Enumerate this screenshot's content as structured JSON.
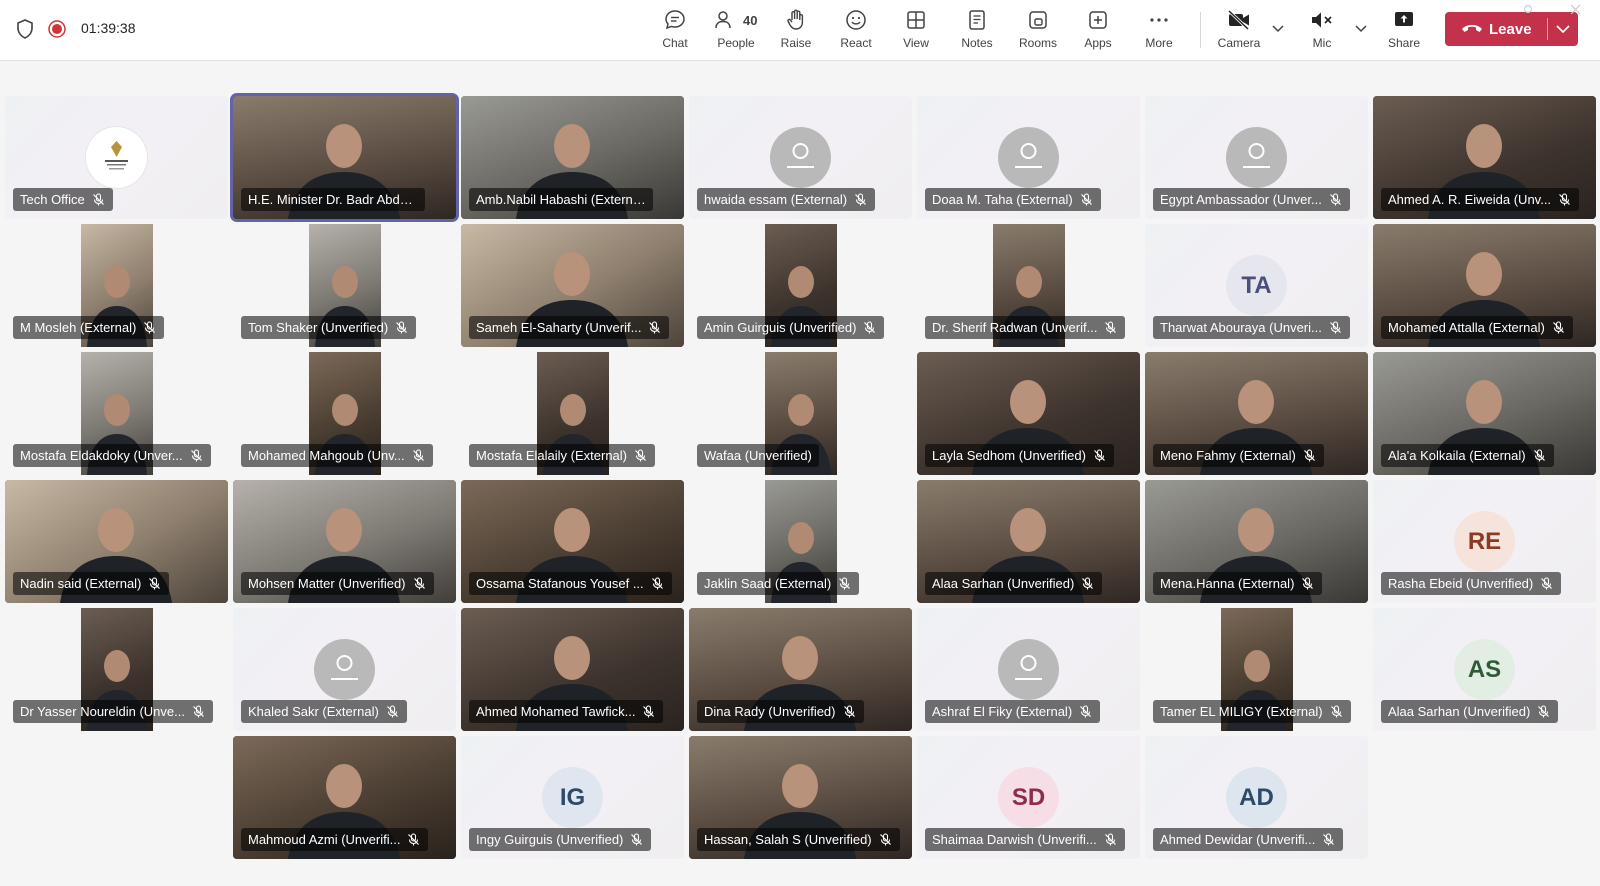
{
  "toolbar": {
    "timer": "01:39:38",
    "chat_label": "Chat",
    "people_label": "People",
    "people_count": "40",
    "raise_label": "Raise",
    "react_label": "React",
    "view_label": "View",
    "notes_label": "Notes",
    "rooms_label": "Rooms",
    "apps_label": "Apps",
    "more_label": "More",
    "camera_label": "Camera",
    "mic_label": "Mic",
    "share_label": "Share",
    "leave_label": "Leave"
  },
  "colors": {
    "leave_red": "#c4314b",
    "active_speaker": "#6264a7",
    "recording_red": "#d13438"
  },
  "participants": [
    {
      "name": "Tech Office",
      "kind": "logo",
      "muted": true
    },
    {
      "name": "H.E. Minister Dr. Badr Abdelatt...",
      "kind": "video",
      "muted": false,
      "active": true
    },
    {
      "name": "Amb.Nabil Habashi (External)",
      "kind": "video",
      "muted": false
    },
    {
      "name": "hwaida essam (External)",
      "kind": "generic-avatar",
      "muted": true
    },
    {
      "name": "Doaa M. Taha (External)",
      "kind": "generic-avatar",
      "muted": true
    },
    {
      "name": "Egypt Ambassador (Unver...",
      "kind": "generic-avatar",
      "muted": true
    },
    {
      "name": "Ahmed A. R. Eiweida (Unv...",
      "kind": "video",
      "muted": true
    },
    {
      "name": "M Mosleh (External)",
      "kind": "narrow-video",
      "muted": true
    },
    {
      "name": "Tom Shaker (Unverified)",
      "kind": "narrow-video",
      "muted": true
    },
    {
      "name": "Sameh El-Saharty (Unverif...",
      "kind": "video",
      "muted": true
    },
    {
      "name": "Amin Guirguis (Unverified)",
      "kind": "narrow-video",
      "muted": true
    },
    {
      "name": "Dr. Sherif Radwan (Unverif...",
      "kind": "narrow-video",
      "muted": true
    },
    {
      "name": "Tharwat Abouraya (Unveri...",
      "kind": "initials",
      "initials": "TA",
      "muted": true
    },
    {
      "name": "Mohamed Attalla (External)",
      "kind": "video",
      "muted": true
    },
    {
      "name": "Mostafa Eldakdoky (Unver...",
      "kind": "narrow-video",
      "muted": true
    },
    {
      "name": "Mohamed Mahgoub (Unv...",
      "kind": "narrow-video",
      "muted": true
    },
    {
      "name": "Mostafa Elalaily (External)",
      "kind": "narrow-video",
      "muted": true
    },
    {
      "name": "Wafaa (Unverified)",
      "kind": "narrow-video",
      "muted": false
    },
    {
      "name": "Layla Sedhom (Unverified)",
      "kind": "video",
      "muted": true
    },
    {
      "name": "Meno Fahmy (External)",
      "kind": "video",
      "muted": true
    },
    {
      "name": "Ala'a Kolkaila (External)",
      "kind": "video",
      "muted": true
    },
    {
      "name": "Nadin said (External)",
      "kind": "video",
      "muted": true
    },
    {
      "name": "Mohsen Matter (Unverified)",
      "kind": "video",
      "muted": true
    },
    {
      "name": "Ossama Stafanous Yousef ...",
      "kind": "video",
      "muted": true
    },
    {
      "name": "Jaklin Saad (External)",
      "kind": "narrow-video",
      "muted": true
    },
    {
      "name": "Alaa Sarhan (Unverified)",
      "kind": "video",
      "muted": true
    },
    {
      "name": "Mena.Hanna (External)",
      "kind": "video",
      "muted": true
    },
    {
      "name": "Rasha Ebeid (Unverified)",
      "kind": "initials",
      "initials": "RE",
      "muted": true
    },
    {
      "name": "Dr Yasser Noureldin (Unve...",
      "kind": "narrow-video",
      "muted": true
    },
    {
      "name": "Khaled Sakr (External)",
      "kind": "generic-avatar",
      "muted": true
    },
    {
      "name": "Ahmed Mohamed Tawfick...",
      "kind": "video",
      "muted": true
    },
    {
      "name": "Dina Rady (Unverified)",
      "kind": "video",
      "muted": true
    },
    {
      "name": "Ashraf El Fiky (External)",
      "kind": "generic-avatar",
      "muted": true
    },
    {
      "name": "Tamer EL MILIGY (External)",
      "kind": "narrow-video",
      "muted": true
    },
    {
      "name": "Alaa Sarhan (Unverified)",
      "kind": "initials",
      "initials": "AS",
      "muted": true
    },
    {
      "name": "Mahmoud Azmi (Unverifi...",
      "kind": "video",
      "muted": true
    },
    {
      "name": "Ingy Guirguis (Unverified)",
      "kind": "initials",
      "initials": "IG",
      "muted": true
    },
    {
      "name": "Hassan, Salah S (Unverified)",
      "kind": "video",
      "muted": true
    },
    {
      "name": "Shaimaa Darwish (Unverifi...",
      "kind": "initials",
      "initials": "SD",
      "muted": true
    },
    {
      "name": "Ahmed Dewidar (Unverifi...",
      "kind": "initials",
      "initials": "AD",
      "muted": true
    }
  ]
}
